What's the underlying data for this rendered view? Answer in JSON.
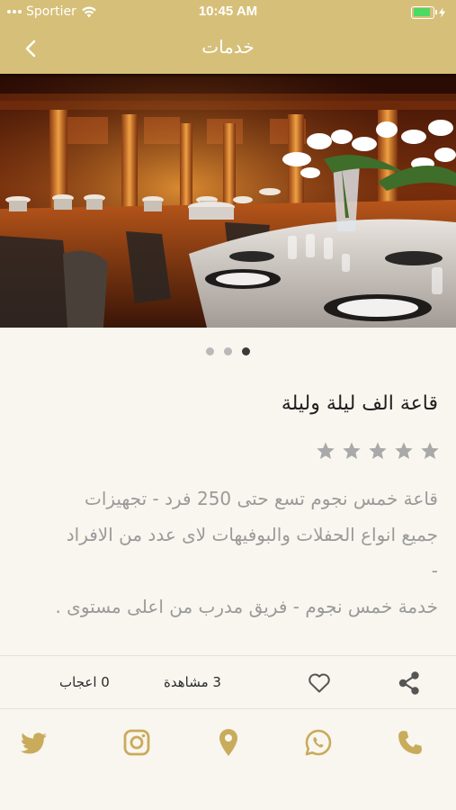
{
  "status_bar": {
    "carrier": "Sportier",
    "time": "10:45 AM",
    "battery_level": 0.9
  },
  "nav": {
    "title": "خدمات"
  },
  "gallery": {
    "page_count": 3,
    "active_index": 2
  },
  "item": {
    "title": "قاعة الف ليلة وليلة",
    "rating": 0,
    "rating_max": 5,
    "description_lines": [
      "قاعة خمس نجوم تسع حتى 250 فرد - تجهيزات",
      "جميع انواع الحفلات والبوفيهات لاى عدد من الافراد",
      "-",
      "خدمة خمس نجوم - فريق مدرب من اعلى مستوى ."
    ]
  },
  "stats": {
    "likes": "0 اعجاب",
    "views": "3 مشاهدة"
  },
  "icons": {
    "back": "chevron-left-icon",
    "share": "share-icon",
    "like": "heart-outline-icon",
    "twitter": "twitter-icon",
    "instagram": "instagram-icon",
    "location": "location-pin-icon",
    "whatsapp": "whatsapp-icon",
    "phone": "phone-icon"
  },
  "colors": {
    "header": "#d6bf78",
    "accent": "#c9ab5c",
    "background": "#f9f6ef",
    "star": "#a9a9a9",
    "description": "#9a9a9a"
  }
}
